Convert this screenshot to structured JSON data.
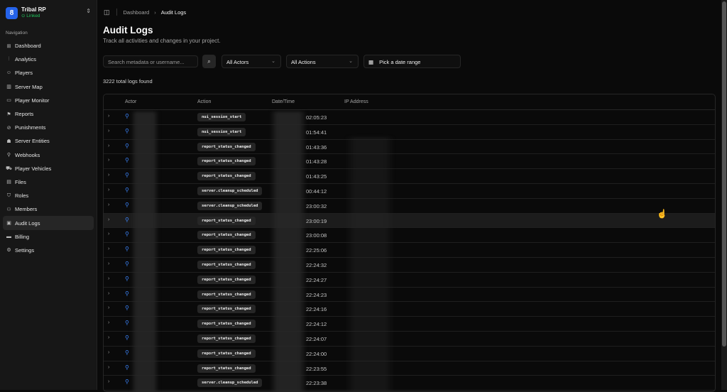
{
  "team": {
    "name": "Tribal RP",
    "status": "Linked",
    "logo_letter": "8"
  },
  "sidebar": {
    "section": "Navigation",
    "items": [
      {
        "label": "Dashboard",
        "icon": "grid-icon"
      },
      {
        "label": "Analytics",
        "icon": "bar-chart-icon"
      },
      {
        "label": "Players",
        "icon": "user-circle-icon"
      },
      {
        "label": "Server Map",
        "icon": "map-icon"
      },
      {
        "label": "Player Monitor",
        "icon": "monitor-icon"
      },
      {
        "label": "Reports",
        "icon": "flag-icon"
      },
      {
        "label": "Punishments",
        "icon": "ban-icon"
      },
      {
        "label": "Server Entities",
        "icon": "boxes-icon"
      },
      {
        "label": "Webhooks",
        "icon": "webhook-icon"
      },
      {
        "label": "Player Vehicles",
        "icon": "truck-icon"
      },
      {
        "label": "Files",
        "icon": "file-icon"
      },
      {
        "label": "Roles",
        "icon": "shield-icon"
      },
      {
        "label": "Members",
        "icon": "users-icon"
      },
      {
        "label": "Audit Logs",
        "icon": "scroll-icon",
        "active": true
      },
      {
        "label": "Billing",
        "icon": "credit-card-icon"
      },
      {
        "label": "Settings",
        "icon": "gear-icon"
      }
    ]
  },
  "breadcrumb": {
    "parent": "Dashboard",
    "current": "Audit Logs"
  },
  "page": {
    "title": "Audit Logs",
    "subtitle": "Track all activities and changes in your project."
  },
  "filters": {
    "search_placeholder": "Search metadata or username...",
    "actors": "All Actors",
    "actions": "All Actions",
    "date": "Pick a date range"
  },
  "count": "3222 total logs found",
  "table": {
    "headers": [
      "Actor",
      "Action",
      "Date/Time",
      "IP Address"
    ],
    "rows": [
      {
        "action": "nui_session_start",
        "time": "02:05:23"
      },
      {
        "action": "nui_session_start",
        "time": "01:54:41"
      },
      {
        "action": "report_status_changed",
        "time": "01:43:36"
      },
      {
        "action": "report_status_changed",
        "time": "01:43:28"
      },
      {
        "action": "report_status_changed",
        "time": "01:43:25"
      },
      {
        "action": "server.cleanup_scheduled",
        "time": "00:44:12"
      },
      {
        "action": "server.cleanup_scheduled",
        "time": "23:00:32"
      },
      {
        "action": "report_status_changed",
        "time": "23:00:19"
      },
      {
        "action": "report_status_changed",
        "time": "23:00:08"
      },
      {
        "action": "report_status_changed",
        "time": "22:25:06"
      },
      {
        "action": "report_status_changed",
        "time": "22:24:32"
      },
      {
        "action": "report_status_changed",
        "time": "22:24:27"
      },
      {
        "action": "report_status_changed",
        "time": "22:24:23"
      },
      {
        "action": "report_status_changed",
        "time": "22:24:16"
      },
      {
        "action": "report_status_changed",
        "time": "22:24:12"
      },
      {
        "action": "report_status_changed",
        "time": "22:24:07"
      },
      {
        "action": "report_status_changed",
        "time": "22:24:00"
      },
      {
        "action": "report_status_changed",
        "time": "22:23:55"
      },
      {
        "action": "server.cleanup_scheduled",
        "time": "22:23:38"
      }
    ]
  }
}
